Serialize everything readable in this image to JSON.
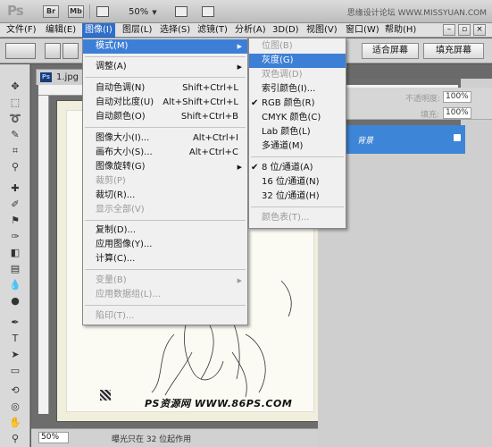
{
  "app": {
    "logo": "Ps",
    "bridge_label": "Br",
    "minibridge_label": "Mb",
    "zoom": "50%",
    "site_credit": "思缘设计论坛  WWW.MISSYUAN.COM"
  },
  "menubar": {
    "items": [
      {
        "label": "文件(F)"
      },
      {
        "label": "编辑(E)"
      },
      {
        "label": "图像(I)"
      },
      {
        "label": "图层(L)"
      },
      {
        "label": "选择(S)"
      },
      {
        "label": "滤镜(T)"
      },
      {
        "label": "分析(A)"
      },
      {
        "label": "3D(D)"
      },
      {
        "label": "视图(V)"
      },
      {
        "label": "窗口(W)"
      },
      {
        "label": "帮助(H)"
      }
    ],
    "window_controls": [
      "–",
      "▫",
      "×"
    ]
  },
  "options": {
    "fit_screen": "适合屏幕",
    "fill_screen": "填充屏幕"
  },
  "document": {
    "tab_label": "1.jpg @",
    "tab_icon": "Ps",
    "watermark": "PS资源网  WWW.86PS.COM",
    "zoom_field": "50%",
    "status": "曝光只在 32 位起作用"
  },
  "layers": {
    "opacity_label": "不透明度:",
    "opacity_value": "100%",
    "fill_label": "填充:",
    "fill_value": "100%",
    "layer_name": "背景"
  },
  "image_menu": {
    "items": [
      {
        "label": "模式(M)",
        "submenu": true,
        "highlighted": true
      },
      {
        "label": "调整(A)",
        "submenu": true
      },
      {
        "label": "自动色调(N)",
        "shortcut": "Shift+Ctrl+L"
      },
      {
        "label": "自动对比度(U)",
        "shortcut": "Alt+Shift+Ctrl+L"
      },
      {
        "label": "自动颜色(O)",
        "shortcut": "Shift+Ctrl+B"
      },
      {
        "label": "图像大小(I)...",
        "shortcut": "Alt+Ctrl+I"
      },
      {
        "label": "画布大小(S)...",
        "shortcut": "Alt+Ctrl+C"
      },
      {
        "label": "图像旋转(G)",
        "submenu": true
      },
      {
        "label": "裁剪(P)",
        "disabled": true
      },
      {
        "label": "裁切(R)..."
      },
      {
        "label": "显示全部(V)",
        "disabled": true
      },
      {
        "label": "复制(D)..."
      },
      {
        "label": "应用图像(Y)..."
      },
      {
        "label": "计算(C)..."
      },
      {
        "label": "变量(B)",
        "submenu": true,
        "disabled": true
      },
      {
        "label": "应用数据组(L)...",
        "disabled": true
      },
      {
        "label": "陷印(T)...",
        "disabled": true
      }
    ]
  },
  "mode_menu": {
    "items": [
      {
        "label": "位图(B)",
        "disabled": true
      },
      {
        "label": "灰度(G)",
        "highlighted": true
      },
      {
        "label": "双色调(D)",
        "disabled": true
      },
      {
        "label": "索引颜色(I)..."
      },
      {
        "label": "RGB 颜色(R)",
        "checked": true
      },
      {
        "label": "CMYK 颜色(C)"
      },
      {
        "label": "Lab 颜色(L)"
      },
      {
        "label": "多通道(M)"
      },
      {
        "label": "8 位/通道(A)",
        "checked": true
      },
      {
        "label": "16 位/通道(N)"
      },
      {
        "label": "32 位/通道(H)"
      },
      {
        "label": "颜色表(T)...",
        "disabled": true
      }
    ],
    "check_glyph": "✔"
  },
  "colors": {
    "highlight": "#3d7fd6",
    "layer_selected": "#3d85d6",
    "menubar_active": "#2f6ec9"
  }
}
